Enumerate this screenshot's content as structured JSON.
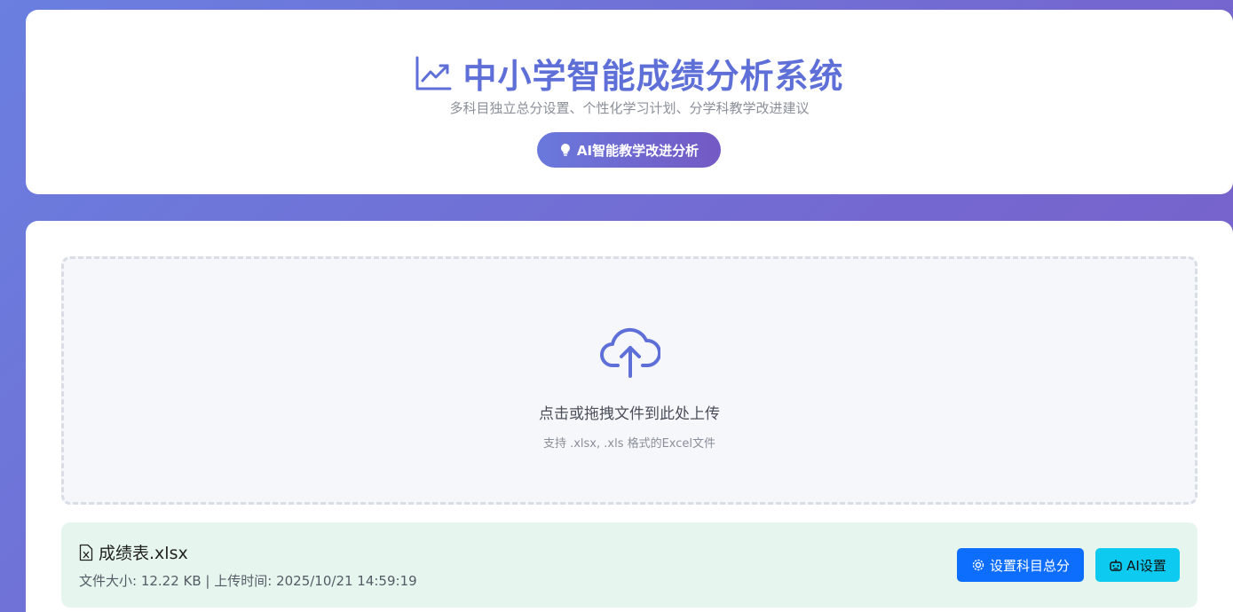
{
  "header": {
    "title": "中小学智能成绩分析系统",
    "title_icon": "line-chart-icon",
    "subtitle": "多科目独立总分设置、个性化学习计划、分学科教学改进建议",
    "ai_button_label": "AI智能教学改进分析",
    "ai_button_icon": "lightbulb-icon"
  },
  "upload": {
    "icon": "cloud-upload-icon",
    "main_text": "点击或拖拽文件到此处上传",
    "hint_text": "支持 .xlsx, .xls 格式的Excel文件"
  },
  "file": {
    "icon": "excel-file-icon",
    "name": "成绩表.xlsx",
    "meta": "文件大小: 12.22 KB | 上传时间: 2025/10/21 14:59:19",
    "buttons": {
      "subject_total_label": "设置科目总分",
      "subject_total_icon": "gear-icon",
      "ai_settings_label": "AI设置",
      "ai_settings_icon": "robot-icon"
    }
  },
  "colors": {
    "accent": "#5f6fd8",
    "primary_button": "#0d6efd",
    "info_button": "#0dcaf0",
    "file_bar_bg": "#e6f6ee"
  }
}
